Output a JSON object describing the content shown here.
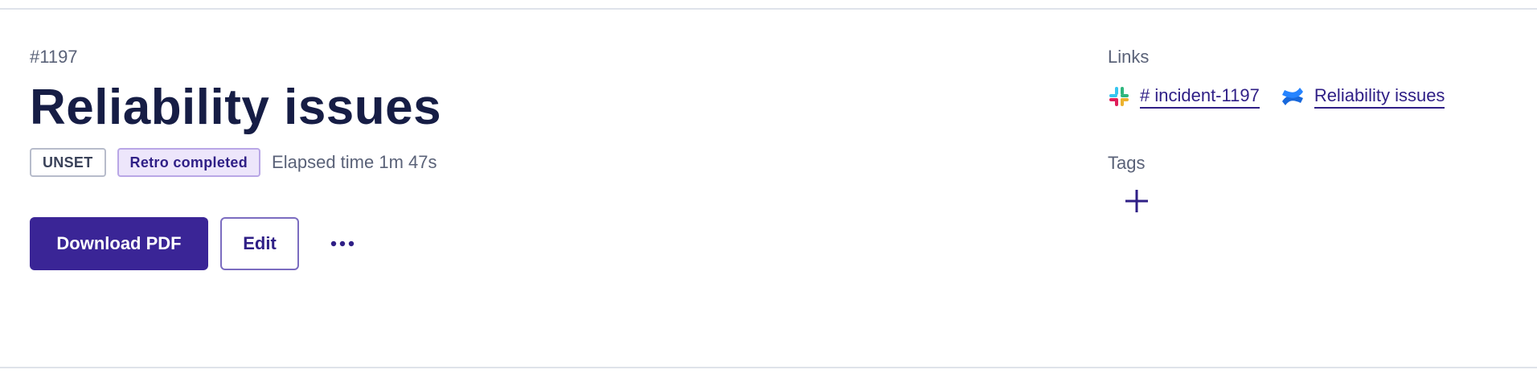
{
  "incident": {
    "id": "#1197",
    "title": "Reliability issues",
    "severity_badge": "UNSET",
    "status_badge": "Retro completed",
    "elapsed": "Elapsed time 1m 47s"
  },
  "actions": {
    "download_label": "Download PDF",
    "edit_label": "Edit",
    "more_icon": "ellipsis-icon"
  },
  "sidebar": {
    "links_label": "Links",
    "links": [
      {
        "icon": "slack-icon",
        "label": "# incident-1197"
      },
      {
        "icon": "confluence-icon",
        "label": "Reliability issues"
      }
    ],
    "tags_label": "Tags",
    "add_tag_icon": "plus-icon"
  },
  "colors": {
    "primary": "#3a2596",
    "title": "#161d45",
    "muted": "#5a6278",
    "link": "#2f1f86",
    "retro_bg": "#ede6fb"
  }
}
